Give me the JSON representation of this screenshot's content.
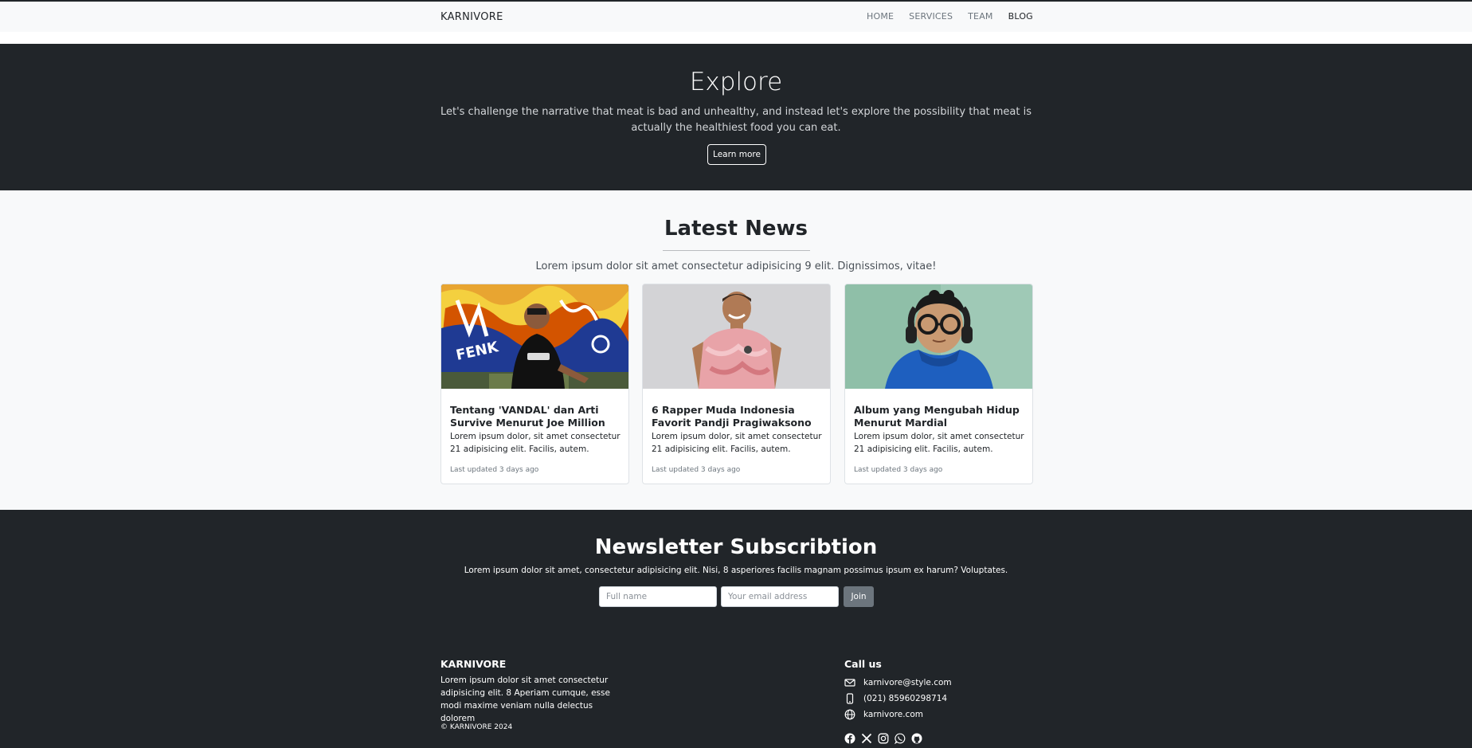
{
  "navbar": {
    "brand": "KARNIVORE",
    "links": [
      "HOME",
      "SERVICES",
      "TEAM",
      "BLOG"
    ]
  },
  "hero": {
    "title": "Explore",
    "text": "Let's challenge the narrative that meat is bad and unhealthy, and instead let's explore the possibility that meat is actually the healthiest food you can eat.",
    "button": "Learn more"
  },
  "news": {
    "title": "Latest News",
    "lead": "Lorem ipsum dolor sit amet consectetur adipisicing 9 elit. Dignissimos, vitae!",
    "cards": [
      {
        "title": "Tentang 'VANDAL' dan Arti Survive Menurut Joe Million",
        "text": "Lorem ipsum dolor, sit amet consectetur 21 adipisicing elit. Facilis, autem.",
        "meta": "Last updated 3 days ago",
        "image": "man-graffiti-wall-photo"
      },
      {
        "title": "6 Rapper Muda Indonesia Favorit Pandji Pragiwaksono",
        "text": "Lorem ipsum dolor, sit amet consectetur 21 adipisicing elit. Facilis, autem.",
        "meta": "Last updated 3 days ago",
        "image": "man-pink-shirt-photo"
      },
      {
        "title": "Album yang Mengubah Hidup Menurut Mardial",
        "text": "Lorem ipsum dolor, sit amet consectetur 21 adipisicing elit. Facilis, autem.",
        "meta": "Last updated 3 days ago",
        "image": "man-headphones-blue-hoodie-photo"
      }
    ]
  },
  "newsletter": {
    "title": "Newsletter Subscribtion",
    "text": "Lorem ipsum dolor sit amet, consectetur adipisicing elit. Nisi, 8 asperiores facilis magnam possimus ipsum ex harum? Voluptates.",
    "name_placeholder": "Full name",
    "email_placeholder": "Your email address",
    "button": "Join"
  },
  "footer": {
    "brand": "KARNIVORE",
    "about": "Lorem ipsum dolor sit amet consectetur adipisicing elit. 8 Aperiam cumque, esse modi maxime veniam nulla delectus dolorem",
    "copyright": "© KARNIVORE 2024",
    "call_title": "Call us",
    "email": "karnivore@style.com",
    "phone": "(021) 85960298714",
    "website": "karnivore.com",
    "social_icons": [
      "facebook-icon",
      "x-icon",
      "instagram-icon",
      "whatsapp-icon",
      "github-icon"
    ]
  },
  "colors": {
    "dark": "#212529",
    "light": "#f8f9fa",
    "muted": "#6c757d"
  }
}
